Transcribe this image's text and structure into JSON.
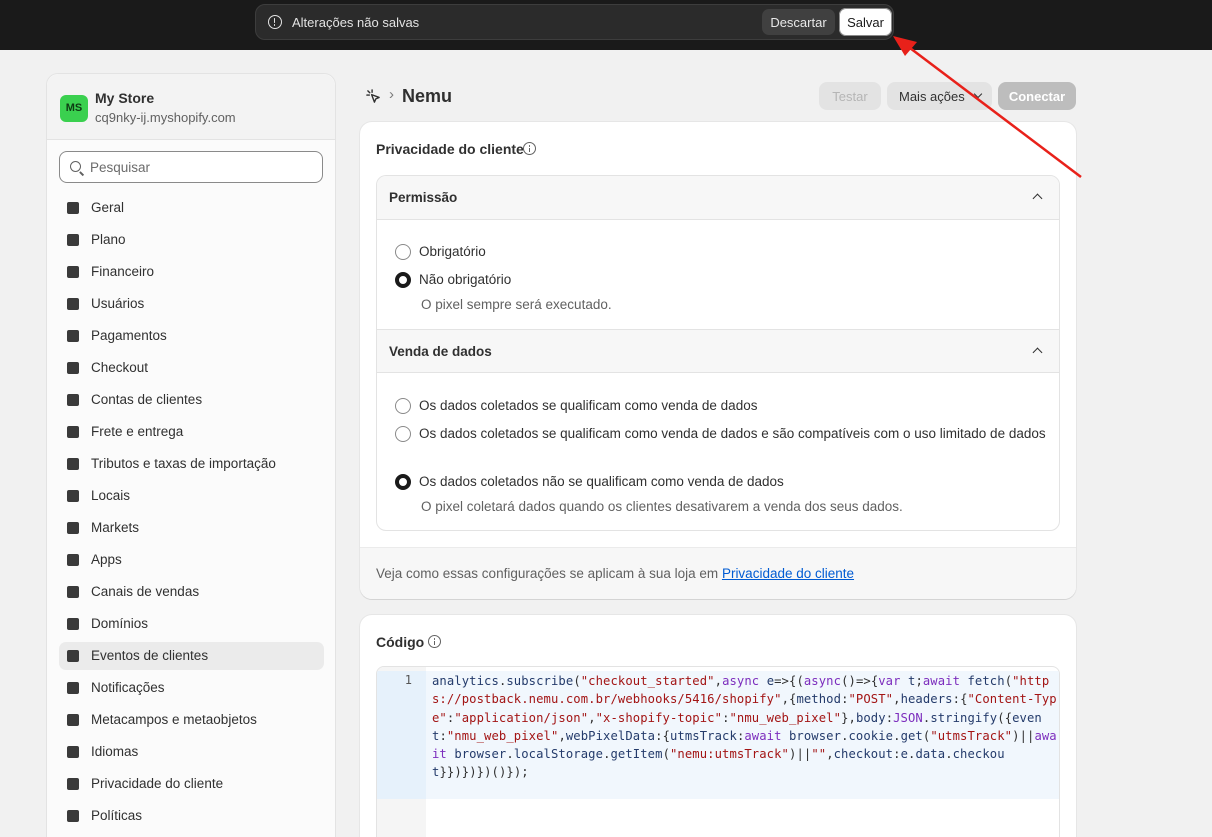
{
  "savebar": {
    "message": "Alterações não salvas",
    "discard_label": "Descartar",
    "save_label": "Salvar"
  },
  "store": {
    "initials": "MS",
    "name": "My Store",
    "url": "cq9nky-ij.myshopify.com"
  },
  "search": {
    "placeholder": "Pesquisar"
  },
  "sidebar": {
    "items": [
      {
        "label": "Geral",
        "icon": "store-icon"
      },
      {
        "label": "Plano",
        "icon": "plan-icon"
      },
      {
        "label": "Financeiro",
        "icon": "billing-icon"
      },
      {
        "label": "Usuários",
        "icon": "users-icon"
      },
      {
        "label": "Pagamentos",
        "icon": "payments-icon"
      },
      {
        "label": "Checkout",
        "icon": "cart-icon"
      },
      {
        "label": "Contas de clientes",
        "icon": "person-icon"
      },
      {
        "label": "Frete e entrega",
        "icon": "truck-icon"
      },
      {
        "label": "Tributos e taxas de importação",
        "icon": "tax-icon"
      },
      {
        "label": "Locais",
        "icon": "location-icon"
      },
      {
        "label": "Markets",
        "icon": "globe-icon"
      },
      {
        "label": "Apps",
        "icon": "apps-icon"
      },
      {
        "label": "Canais de vendas",
        "icon": "channels-icon"
      },
      {
        "label": "Domínios",
        "icon": "domains-icon"
      },
      {
        "label": "Eventos de clientes",
        "icon": "pixel-icon",
        "active": true
      },
      {
        "label": "Notificações",
        "icon": "bell-icon"
      },
      {
        "label": "Metacampos e metaobjetos",
        "icon": "metafields-icon"
      },
      {
        "label": "Idiomas",
        "icon": "languages-icon"
      },
      {
        "label": "Privacidade do cliente",
        "icon": "lock-icon"
      },
      {
        "label": "Políticas",
        "icon": "policies-icon"
      }
    ]
  },
  "header": {
    "separator": "›",
    "title": "Nemu",
    "test_label": "Testar",
    "more_label": "Mais ações",
    "connect_label": "Conectar"
  },
  "privacy": {
    "title": "Privacidade do cliente",
    "permission": {
      "title": "Permissão",
      "options": [
        "Obrigatório",
        "Não obrigatório"
      ],
      "selected": 1,
      "help": "O pixel sempre será executado."
    },
    "data_sale": {
      "title": "Venda de dados",
      "options": [
        "Os dados coletados se qualificam como venda de dados",
        "Os dados coletados se qualificam como venda de dados e são compatíveis com o uso limitado de dados",
        "Os dados coletados não se qualificam como venda de dados"
      ],
      "selected": 2,
      "help": "O pixel coletará dados quando os clientes desativarem a venda dos seus dados."
    },
    "footer_text": "Veja como essas configurações se aplicam à sua loja em ",
    "footer_link": "Privacidade do cliente"
  },
  "code": {
    "title": "Código",
    "line_number": "1",
    "source": "analytics.subscribe(\"checkout_started\",async e=>{(async()=>{var t;await fetch(\"https://postback.nemu.com.br/webhooks/5416/shopify\",{method:\"POST\",headers:{\"Content-Type\":\"application/json\",\"x-shopify-topic\":\"nmu_web_pixel\"},body:JSON.stringify({event:\"nmu_web_pixel\",webPixelData:{utmsTrack:await browser.cookie.get(\"utmsTrack\")||await browser.localStorage.getItem(\"nemu:utmsTrack\")||\"\",checkout:e.data.checkout}})})})()});"
  },
  "colors": {
    "accent_link": "#005bd3",
    "annotation_arrow": "#e8211a",
    "avatar": "#3ad04f"
  }
}
